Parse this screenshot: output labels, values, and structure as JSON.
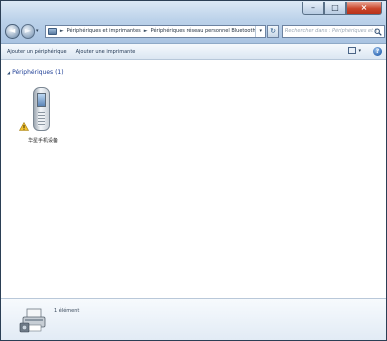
{
  "window": {
    "caption_buttons": {
      "minimize_glyph": "–",
      "maximize_glyph": "□",
      "close_glyph": "×"
    }
  },
  "navigation": {
    "back_glyph": "◄",
    "forward_glyph": "►",
    "history_glyph": "▾",
    "address": {
      "crumbs": [
        "Périphériques et imprimantes",
        "Périphériques réseau personnel Bluetooth"
      ],
      "separator": "►",
      "dropdown_glyph": "▾"
    },
    "refresh_glyph": "↻",
    "search": {
      "placeholder": "Rechercher dans : Périphériques et im..."
    }
  },
  "commandbar": {
    "add_device_label": "Ajouter un périphérique",
    "add_printer_label": "Ajouter une imprimante",
    "view_dropdown_glyph": "▾",
    "help_glyph": "?"
  },
  "content": {
    "group": {
      "arrow_glyph": "◢",
      "label": "Périphériques (1)"
    },
    "devices": [
      {
        "label": "华星手机设备",
        "icon": "mobile-phone-icon",
        "status_icon": "warning-icon"
      }
    ]
  },
  "details": {
    "count_label": "1 élément",
    "icon": "devices-printers-icon"
  },
  "colors": {
    "glass": "#bcd2ea",
    "group_header_text": "#1e3e96",
    "close_button": "#c9452a"
  }
}
